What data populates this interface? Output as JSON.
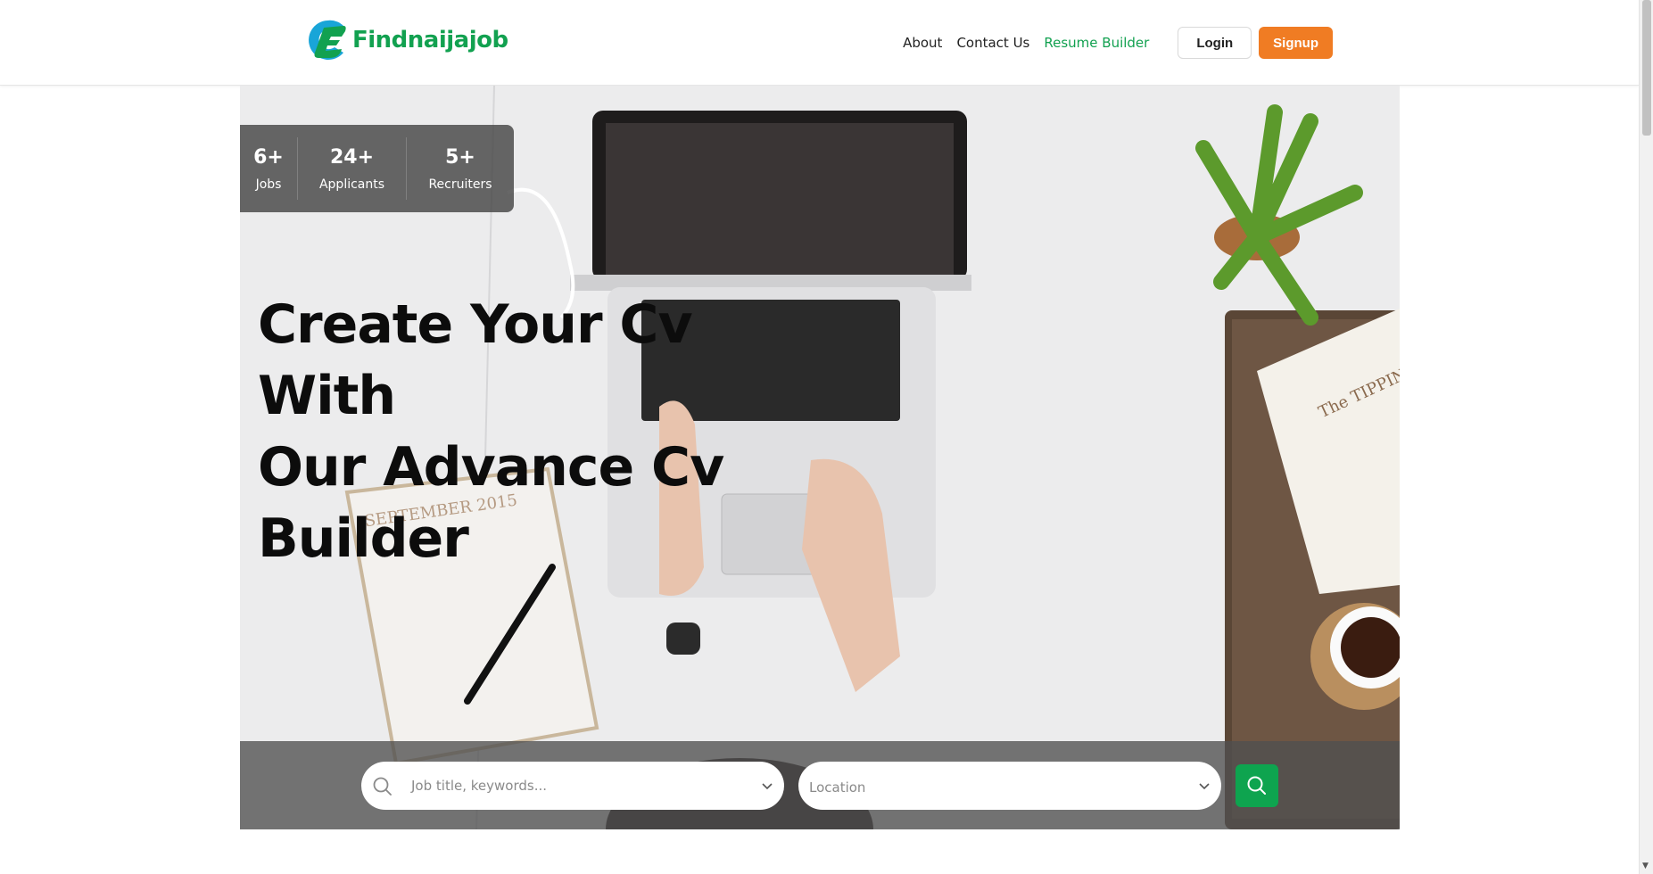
{
  "brand": {
    "name": "Findnaijajob",
    "primary_color": "#12a150",
    "accent_color": "#f07c23"
  },
  "nav": {
    "links": [
      {
        "label": "About"
      },
      {
        "label": "Contact Us"
      },
      {
        "label": "Resume Builder"
      }
    ],
    "login_label": "Login",
    "signup_label": "Signup"
  },
  "stats": [
    {
      "value": "6+",
      "label": "Jobs"
    },
    {
      "value": "24+",
      "label": "Applicants"
    },
    {
      "value": "5+",
      "label": "Recruiters"
    }
  ],
  "hero": {
    "headline_lines": [
      "Create Your Cv With",
      "Our Advance Cv",
      "Builder"
    ],
    "calendar_text": "SEPTEMBER 2015",
    "book_text": "The TIPPING PO"
  },
  "search": {
    "keywords_placeholder": "Job title, keywords...",
    "location_placeholder": "Location",
    "search_icon": "search-icon",
    "button_color": "#0ea44f"
  }
}
